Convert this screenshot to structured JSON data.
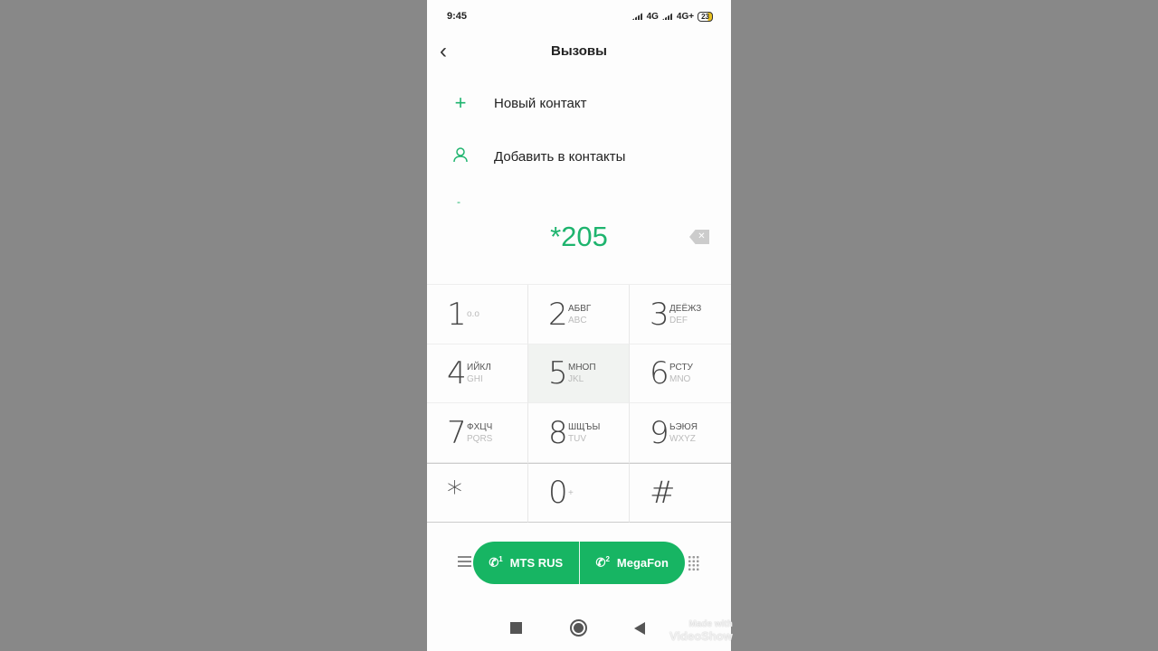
{
  "status": {
    "time": "9:45",
    "sim1": "4G",
    "sim2": "4G+",
    "battery": "23"
  },
  "header": {
    "title": "Вызовы"
  },
  "menu": [
    {
      "label": "Новый контакт",
      "icon": "plus-icon"
    },
    {
      "label": "Добавить в контакты",
      "icon": "person-icon"
    }
  ],
  "dialer": {
    "number": "*205"
  },
  "keys": [
    {
      "d": "1",
      "ru": "",
      "en": "o.o"
    },
    {
      "d": "2",
      "ru": "АБВГ",
      "en": "ABC"
    },
    {
      "d": "3",
      "ru": "ДЕЁЖЗ",
      "en": "DEF"
    },
    {
      "d": "4",
      "ru": "ИЙКЛ",
      "en": "GHI"
    },
    {
      "d": "5",
      "ru": "МНОП",
      "en": "JKL"
    },
    {
      "d": "6",
      "ru": "РСТУ",
      "en": "MNO"
    },
    {
      "d": "7",
      "ru": "ФХЦЧ",
      "en": "PQRS"
    },
    {
      "d": "8",
      "ru": "ШЩЪЫ",
      "en": "TUV"
    },
    {
      "d": "9",
      "ru": "ЬЭЮЯ",
      "en": "WXYZ"
    },
    {
      "d": "*",
      "ru": "",
      "en": ""
    },
    {
      "d": "0",
      "ru": "",
      "en": "+"
    },
    {
      "d": "#",
      "ru": "",
      "en": ""
    }
  ],
  "call": {
    "sim1_label": "MTS RUS",
    "sim1_num": "1",
    "sim2_label": "MegaFon",
    "sim2_num": "2"
  },
  "watermark": {
    "line1": "Made with",
    "line2": "VideoShow"
  },
  "colors": {
    "accent": "#17b563"
  }
}
